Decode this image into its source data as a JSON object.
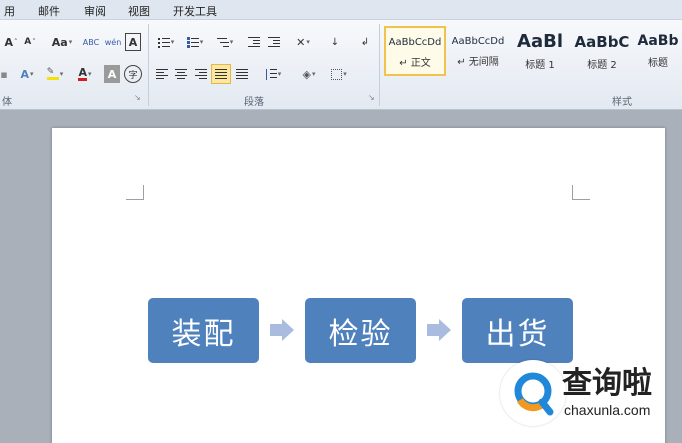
{
  "menu_tabs": [
    "用",
    "邮件",
    "审阅",
    "视图",
    "开发工具"
  ],
  "ribbon": {
    "font_group_label": "体",
    "paragraph_group_label": "段落",
    "styles_group_label": "样式",
    "font_buttons": {
      "grow": "A",
      "shrink": "A",
      "change_case": "Aa",
      "clear_format": "ABC",
      "phonetic": "wén",
      "char_border": "A",
      "text_effect": "A",
      "font_color": "A",
      "char_shading": "A",
      "enclose": "字"
    },
    "styles": [
      {
        "sample": "AaBbCcDd",
        "name": "正文",
        "prefix": "↵"
      },
      {
        "sample": "AaBbCcDd",
        "name": "无间隔",
        "prefix": "↵"
      },
      {
        "sample": "AaBl",
        "name": "标题 1",
        "prefix": ""
      },
      {
        "sample": "AaBbC",
        "name": "标题 2",
        "prefix": ""
      },
      {
        "sample": "AaBb",
        "name": "标题",
        "prefix": ""
      }
    ],
    "colors": {
      "highlight": "#f5e10a",
      "font_color": "#d61c1c",
      "selected_style": "#f0c24e"
    }
  },
  "document": {
    "smartart_steps": [
      "装配",
      "检验",
      "出货"
    ],
    "colors": {
      "node": "#4f81bd",
      "arrow": "#a9bce0"
    }
  },
  "watermark": {
    "text": "查询啦",
    "url": "chaxunla.com",
    "colors": {
      "blue": "#1f88d8",
      "orange": "#f29a1f"
    }
  }
}
